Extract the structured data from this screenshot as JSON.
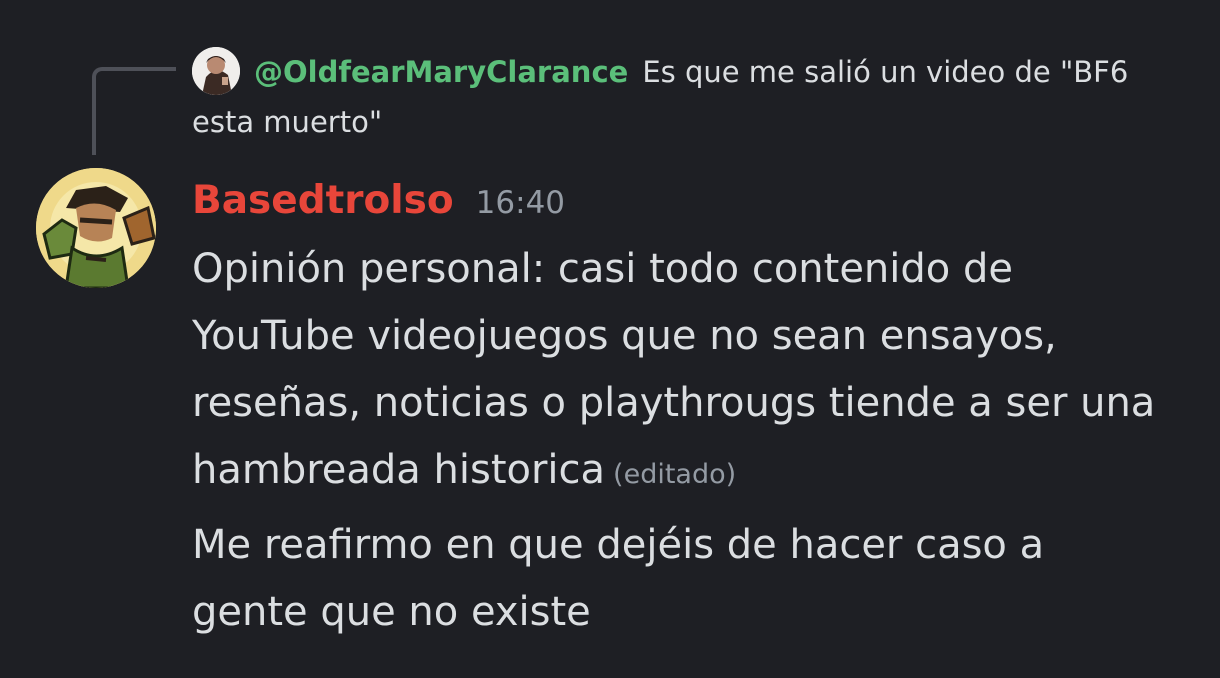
{
  "reply": {
    "author": "@OldfearMaryClarance",
    "text_line1": "Es que me salió un video de \"BF6",
    "text_line2": "esta muerto\""
  },
  "message": {
    "author": "Basedtrolso",
    "timestamp": "16:40",
    "author_color": "#e8463a",
    "lines": [
      "Opinión personal: casi todo contenido de",
      "YouTube videojuegos que no sean ensayos,",
      "reseñas, noticias o playthrougs tiende a ser una",
      "hambreada historica"
    ],
    "edited_label": "(editado)"
  },
  "followup": {
    "lines": [
      "Me reafirmo en que dejéis de hacer caso a",
      "gente que no existe"
    ]
  },
  "colors": {
    "background": "#1e1f24",
    "reply_author": "#5bbf7a",
    "muted": "#949ba4",
    "text": "#dbdee1"
  }
}
